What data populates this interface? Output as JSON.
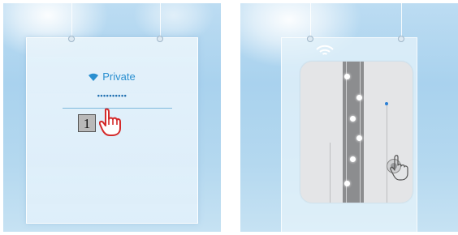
{
  "left_panel": {
    "network_name": "Private",
    "password_mask": "••••••••••",
    "key_label": "1"
  },
  "icons": {
    "wifi": "wifi-icon",
    "pointer_hand": "pointer-hand-icon",
    "touch_hand": "touch-hand-icon"
  },
  "colors": {
    "accent_blue": "#2a8fd0",
    "hand_red": "#d42a2a",
    "phone_gray": "#e4e5e7",
    "strip_gray": "#8c8d8f"
  }
}
